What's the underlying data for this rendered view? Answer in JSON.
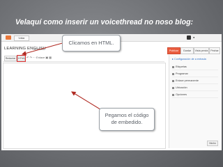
{
  "slide": {
    "title": "Velaquí como inserir un voicethread no noso blog:"
  },
  "blogger": {
    "topbar_button": "Voltar",
    "blog_title": "LEARNING ENGLISH",
    "post_label": "Entrada",
    "actions": {
      "publish": "Publicar",
      "save": "Gardar",
      "preview": "Vista previa",
      "close": "Pechar"
    },
    "tabs": {
      "compose": "Redactar",
      "html": "HTML"
    },
    "toolbar_icons": "↶  ↷  ⋯  Enlace  ▣  ▦",
    "sidebar": {
      "heading": "▸ Configuración de a entrada",
      "items": [
        "Etiquetas",
        "Programar",
        "Enlace permanente",
        "Ubicación",
        "Opciones"
      ],
      "done_label": "Hecho"
    }
  },
  "callouts": {
    "html_click": "Clicamos en HTML.",
    "paste_code_line1": "Pegamos el código",
    "paste_code_line2": "de embedido."
  },
  "colors": {
    "arrow": "#b02a22",
    "html_highlight": "#e03232",
    "publish": "#e95d40"
  }
}
